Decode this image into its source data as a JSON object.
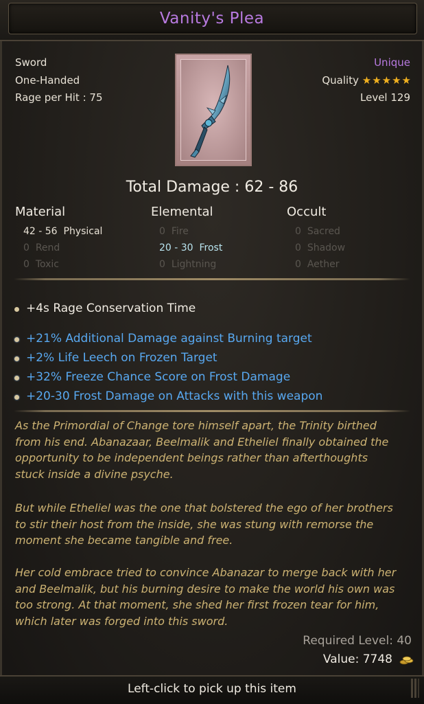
{
  "item": {
    "name": "Vanity's Plea",
    "type": "Sword",
    "handedness": "One-Handed",
    "rage_per_hit": "Rage per Hit : 75",
    "rarity": "Unique",
    "quality_label": "Quality",
    "quality_stars": "★★★★★",
    "level": "Level 129",
    "total_damage": "Total Damage : 62 - 86"
  },
  "damage": {
    "material": {
      "header": "Material",
      "rows": [
        {
          "range": "42 - 56",
          "type": "Physical"
        },
        {
          "range": "0",
          "type": "Rend"
        },
        {
          "range": "0",
          "type": "Toxic"
        }
      ]
    },
    "elemental": {
      "header": "Elemental",
      "rows": [
        {
          "range": "0",
          "type": "Fire"
        },
        {
          "range": "20 - 30",
          "type": "Frost"
        },
        {
          "range": "0",
          "type": "Lightning"
        }
      ]
    },
    "occult": {
      "header": "Occult",
      "rows": [
        {
          "range": "0",
          "type": "Sacred"
        },
        {
          "range": "0",
          "type": "Shadow"
        },
        {
          "range": "0",
          "type": "Aether"
        }
      ]
    }
  },
  "base_attribute": "+4s Rage Conservation Time",
  "bonus_attributes": [
    "+21% Additional Damage against Burning target",
    "+2% Life Leech on Frozen Target",
    "+32% Freeze Chance Score on Frost Damage",
    "+20-30 Frost Damage on Attacks with this weapon"
  ],
  "lore": {
    "p1": [
      "As the Primordial of Change tore himself apart, the Trinity birthed",
      "from his end. Abanazaar, Beelmalik and Etheliel finally obtained the",
      "opportunity to be independent beings rather than afterthoughts",
      "stuck inside a divine psyche."
    ],
    "p2": [
      "But while Etheliel was the one that bolstered the ego of her brothers",
      "to stir their host from the inside, she was stung with remorse the",
      "moment she became tangible and free."
    ],
    "p3": [
      "Her cold embrace tried to convince Abanazar to merge back with her",
      "and Beelmalik, but his burning desire to make the world his own was",
      "too strong.  At that moment, she shed her first frozen tear for him,",
      "which later was forged into this sword."
    ]
  },
  "required_level": "Required Level: 40",
  "value": "Value: 7748",
  "hint": "Left-click to pick up this item",
  "colors": {
    "unique": "#b87ae0",
    "bonus_text": "#58a8f0",
    "lore_text": "#cdb373",
    "frost": "#b9e4ef"
  },
  "icons": [
    "sword-icon",
    "star-icon",
    "gold-coins-icon",
    "bullet-icon",
    "resize-grip-icon"
  ]
}
